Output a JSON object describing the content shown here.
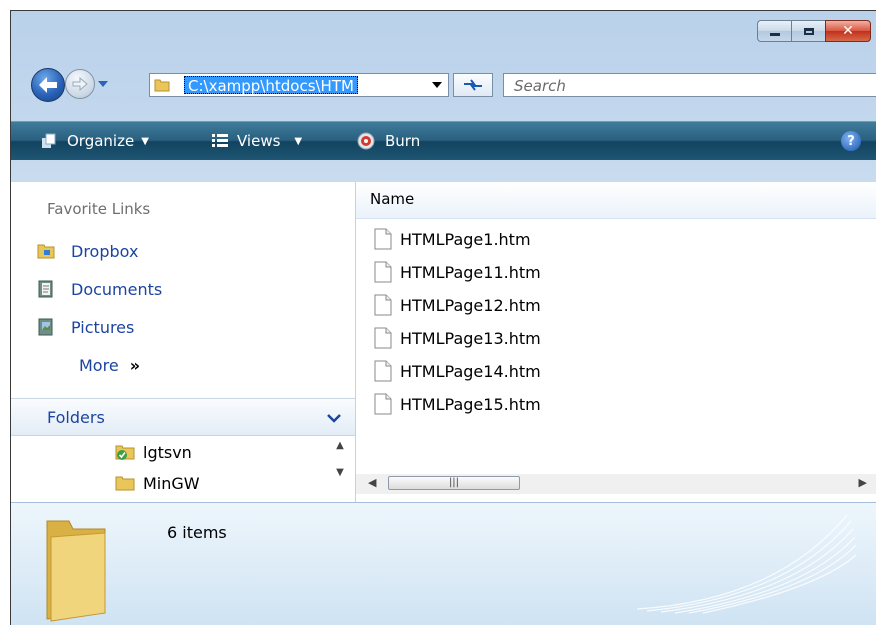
{
  "address": {
    "path": "C:\\xampp\\htdocs\\HTM"
  },
  "search": {
    "placeholder": "Search"
  },
  "toolbar": {
    "organize": "Organize",
    "views": "Views",
    "burn": "Burn",
    "help": "?"
  },
  "nav": {
    "favorite_header": "Favorite Links",
    "links": [
      {
        "label": "Dropbox"
      },
      {
        "label": "Documents"
      },
      {
        "label": "Pictures"
      }
    ],
    "more": "More",
    "folders_title": "Folders",
    "tree": [
      {
        "label": "lgtsvn"
      },
      {
        "label": "MinGW"
      }
    ]
  },
  "files": {
    "column_name": "Name",
    "items": [
      {
        "name": "HTMLPage1.htm"
      },
      {
        "name": "HTMLPage11.htm"
      },
      {
        "name": "HTMLPage12.htm"
      },
      {
        "name": "HTMLPage13.htm"
      },
      {
        "name": "HTMLPage14.htm"
      },
      {
        "name": "HTMLPage15.htm"
      }
    ]
  },
  "details": {
    "count": "6 items"
  },
  "colors": {
    "toolbar": "#1e5673",
    "link": "#1c45a0",
    "selection": "#3399ff",
    "close": "#c0301a"
  }
}
